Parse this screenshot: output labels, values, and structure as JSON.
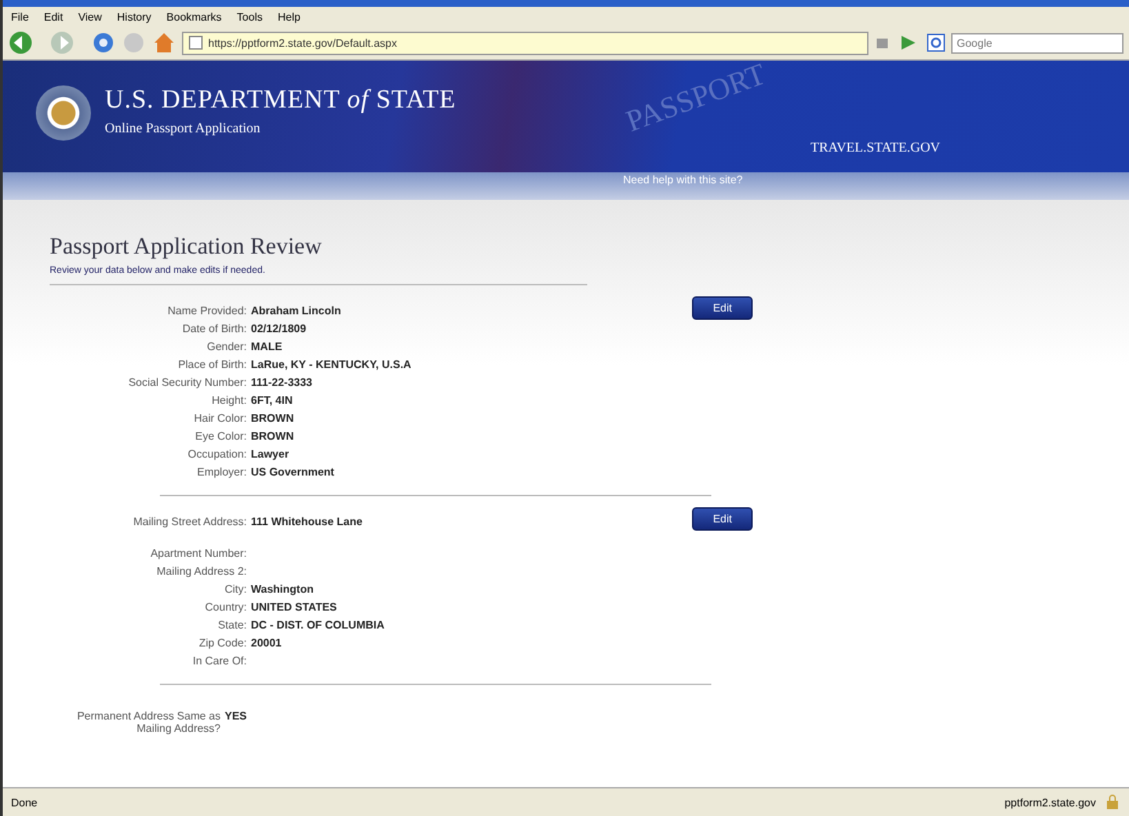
{
  "browser": {
    "menu": [
      "File",
      "Edit",
      "View",
      "History",
      "Bookmarks",
      "Tools",
      "Help"
    ],
    "url": "https://pptform2.state.gov/Default.aspx",
    "search": {
      "placeholder": "Google"
    }
  },
  "header": {
    "title": "U.S. DEPARTMENT *of* STATE",
    "subtitle": "Online Passport Application",
    "watermark": "PASSPORT",
    "site": "TRAVEL.STATE.GOV",
    "help": "Need help with this site?"
  },
  "page": {
    "title": "Passport Application Review",
    "subtitle": "Review your data below and make edits if needed."
  },
  "sections": [
    {
      "edit": "Edit",
      "rows": [
        {
          "label": "Name Provided:",
          "value": "Abraham Lincoln"
        },
        {
          "label": "Date of Birth:",
          "value": "02/12/1809"
        },
        {
          "label": "Gender:",
          "value": "MALE"
        },
        {
          "label": "Place of Birth:",
          "value": "LaRue, KY - KENTUCKY, U.S.A"
        },
        {
          "label": "Social Security Number:",
          "value": "111-22-3333"
        },
        {
          "label": "Height:",
          "value": "6FT, 4IN"
        },
        {
          "label": "Hair Color:",
          "value": "BROWN"
        },
        {
          "label": "Eye Color:",
          "value": "BROWN"
        },
        {
          "label": "Occupation:",
          "value": "Lawyer"
        },
        {
          "label": "Employer:",
          "value": "US Government"
        }
      ]
    },
    {
      "edit": "Edit",
      "rows": [
        {
          "label": "Mailing Street Address:",
          "value": "111 Whitehouse Lane"
        },
        {
          "label": "Apartment Number:"
        },
        {
          "label": "Mailing Address 2:"
        },
        {
          "label": "City:",
          "value": "Washington"
        },
        {
          "label": "Country:",
          "value": "UNITED STATES"
        },
        {
          "label": "State:",
          "value": "DC - DIST. OF COLUMBIA"
        },
        {
          "label": "Zip Code:",
          "value": "20001"
        },
        {
          "label": "In Care Of:"
        }
      ]
    },
    {
      "rows": [
        {
          "label": "Permanent Address Same as Mailing Address?",
          "value": "YES"
        }
      ]
    }
  ],
  "status_bar": {
    "text": "Done",
    "host": "pptform2.state.gov"
  }
}
